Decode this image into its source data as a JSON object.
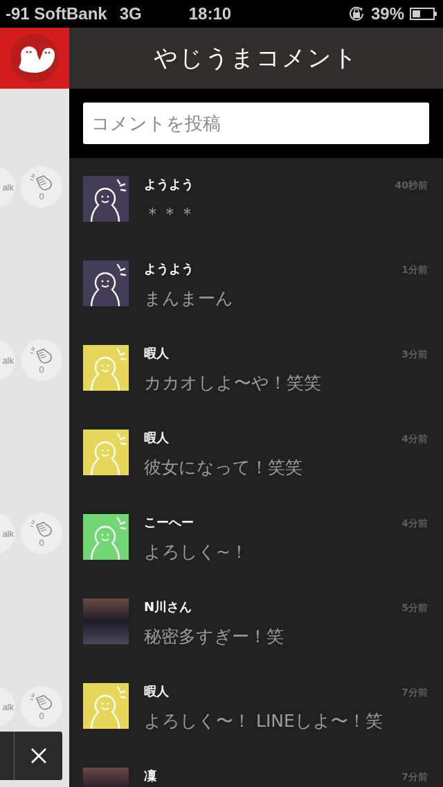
{
  "status_bar": {
    "carrier": "-91 SoftBank",
    "network": "3G",
    "time": "18:10",
    "battery": "39%"
  },
  "background_page": {
    "cards": [
      {
        "talk_label": "alk",
        "claps": "0"
      },
      {
        "talk_label": "alk",
        "claps": "0"
      },
      {
        "talk_label": "alk",
        "claps": "0"
      },
      {
        "talk_label": "alk",
        "claps": "0"
      }
    ]
  },
  "header": {
    "title": "やじうまコメント"
  },
  "comment_field": {
    "placeholder": "コメントを投稿"
  },
  "comments": [
    {
      "kind": "figure",
      "color": "#433d5a",
      "name": "ようよう",
      "time": "40秒前",
      "message": "＊＊＊"
    },
    {
      "kind": "figure",
      "color": "#433d5a",
      "name": "ようよう",
      "time": "1分前",
      "message": "まんまーん"
    },
    {
      "kind": "figure",
      "color": "#e6d75a",
      "name": "暇人",
      "time": "3分前",
      "message": "カカオしよ〜や！笑笑"
    },
    {
      "kind": "figure",
      "color": "#e6d75a",
      "name": "暇人",
      "time": "4分前",
      "message": "彼女になって！笑笑"
    },
    {
      "kind": "figure",
      "color": "#74d776",
      "name": "こーへー",
      "time": "4分前",
      "message": "よろしく~！"
    },
    {
      "kind": "photo",
      "name": "N川さん",
      "time": "5分前",
      "message": "秘密多すぎー！笑"
    },
    {
      "kind": "figure",
      "color": "#e6d75a",
      "name": "暇人",
      "time": "7分前",
      "message": "よろしく〜！ LINEしよ〜！笑"
    },
    {
      "kind": "photo",
      "name": "凜",
      "time": "7分前"
    }
  ]
}
